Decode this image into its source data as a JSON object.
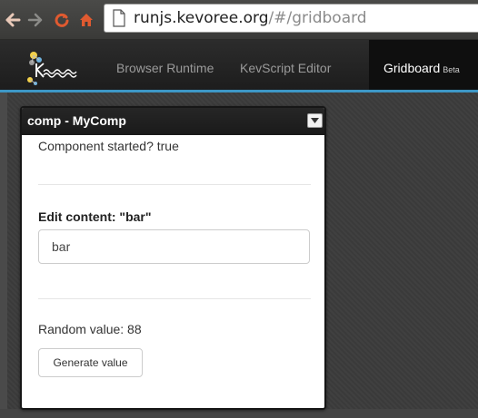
{
  "browser": {
    "url_domain": "runjs.kevoree.org",
    "url_path": "/#/gridboard",
    "icons": [
      "back-icon",
      "forward-icon",
      "reload-icon",
      "home-icon",
      "page-icon"
    ]
  },
  "appnav": {
    "logo_text": "Kevoree",
    "items": [
      {
        "label": "Browser Runtime"
      },
      {
        "label": "KevScript Editor"
      },
      {
        "label": "Gridboard",
        "badge": "Beta",
        "active": true
      }
    ],
    "accent_color": "#3d97c6"
  },
  "widget": {
    "title": "comp - MyComp",
    "toggle_icon": "chevron-down-icon",
    "status_text": "Component started? true",
    "edit_label": "Edit content: \"bar\"",
    "input_value": "bar",
    "random_text": "Random value: 88",
    "button_label": "Generate value"
  }
}
